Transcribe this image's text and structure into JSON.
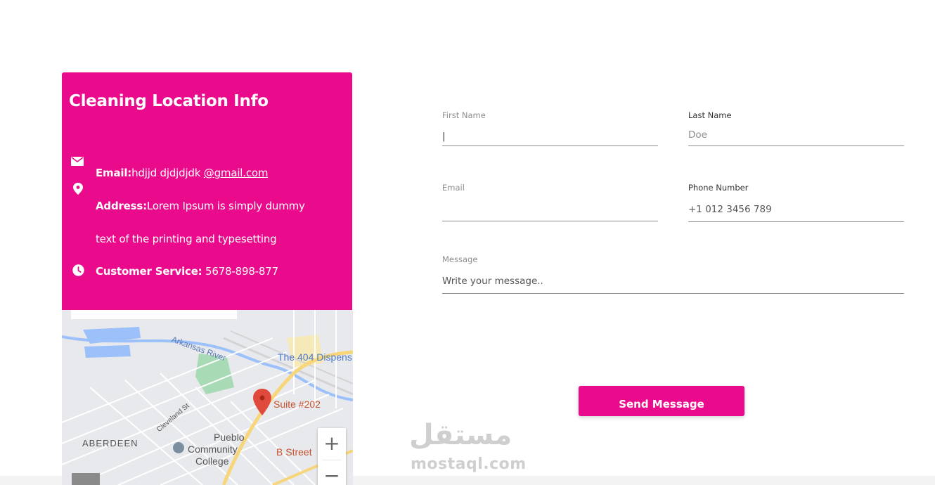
{
  "info": {
    "title": "Cleaning Location Info",
    "email_label": "Email:",
    "email_value": "hdjjd djdjdjdk ",
    "email_link": "@gmail.com",
    "address_label": "Address:",
    "address_line1": "Lorem Ipsum is simply dummy",
    "address_line2": "text of the printing and typesetting",
    "service_label": "Customer Service:",
    "service_value": " 5678-898-877"
  },
  "icons": {
    "email": "mail-icon",
    "address": "location-pin-icon",
    "service": "clock-icon"
  },
  "map": {
    "river_label": "Arkansas River",
    "place_label": "The 404 Dispens",
    "marker_label": "Suite #202",
    "district_label": "ABERDEEN",
    "street_label": "Cleveland St",
    "college_line1": "Pueblo",
    "college_line2": "Community",
    "college_line3": "College",
    "street2_label": "B Street",
    "zoom_in": "+",
    "zoom_out": "−"
  },
  "form": {
    "first_name": {
      "label": "First Name",
      "value": "|",
      "placeholder": ""
    },
    "last_name": {
      "label": "Last Name",
      "value": "",
      "placeholder": "Doe"
    },
    "email": {
      "label": "Email",
      "value": "",
      "placeholder": ""
    },
    "phone": {
      "label": "Phone Number",
      "value": "",
      "placeholder": "+1 012 3456 789"
    },
    "message": {
      "label": "Message",
      "value": "",
      "placeholder": "Write your message.."
    },
    "send_label": "Send Message"
  },
  "watermark": {
    "arabic": "مستقل",
    "latin": "mostaql.com"
  },
  "colors": {
    "brand": "#ea0a8c",
    "input_border": "#8d8d8d",
    "map_marker": "#e04a3c"
  }
}
